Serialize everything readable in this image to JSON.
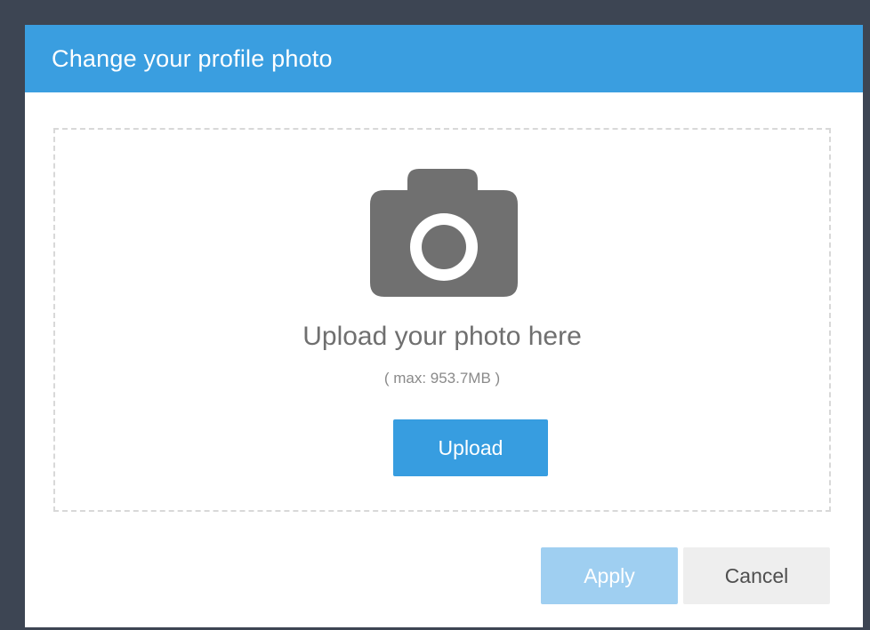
{
  "dialog": {
    "title": "Change your profile photo"
  },
  "dropzone": {
    "icon": "camera-icon",
    "title": "Upload your photo here",
    "limit_text": "( max: 953.7MB )",
    "upload_label": "Upload"
  },
  "footer": {
    "apply_label": "Apply",
    "cancel_label": "Cancel"
  },
  "colors": {
    "header_bg": "#3a9ee0",
    "primary_button": "#379de0",
    "disabled_apply": "#9fcff1",
    "cancel_bg": "#eeeeee",
    "backdrop": "#3d4553",
    "icon_gray": "#707070"
  }
}
